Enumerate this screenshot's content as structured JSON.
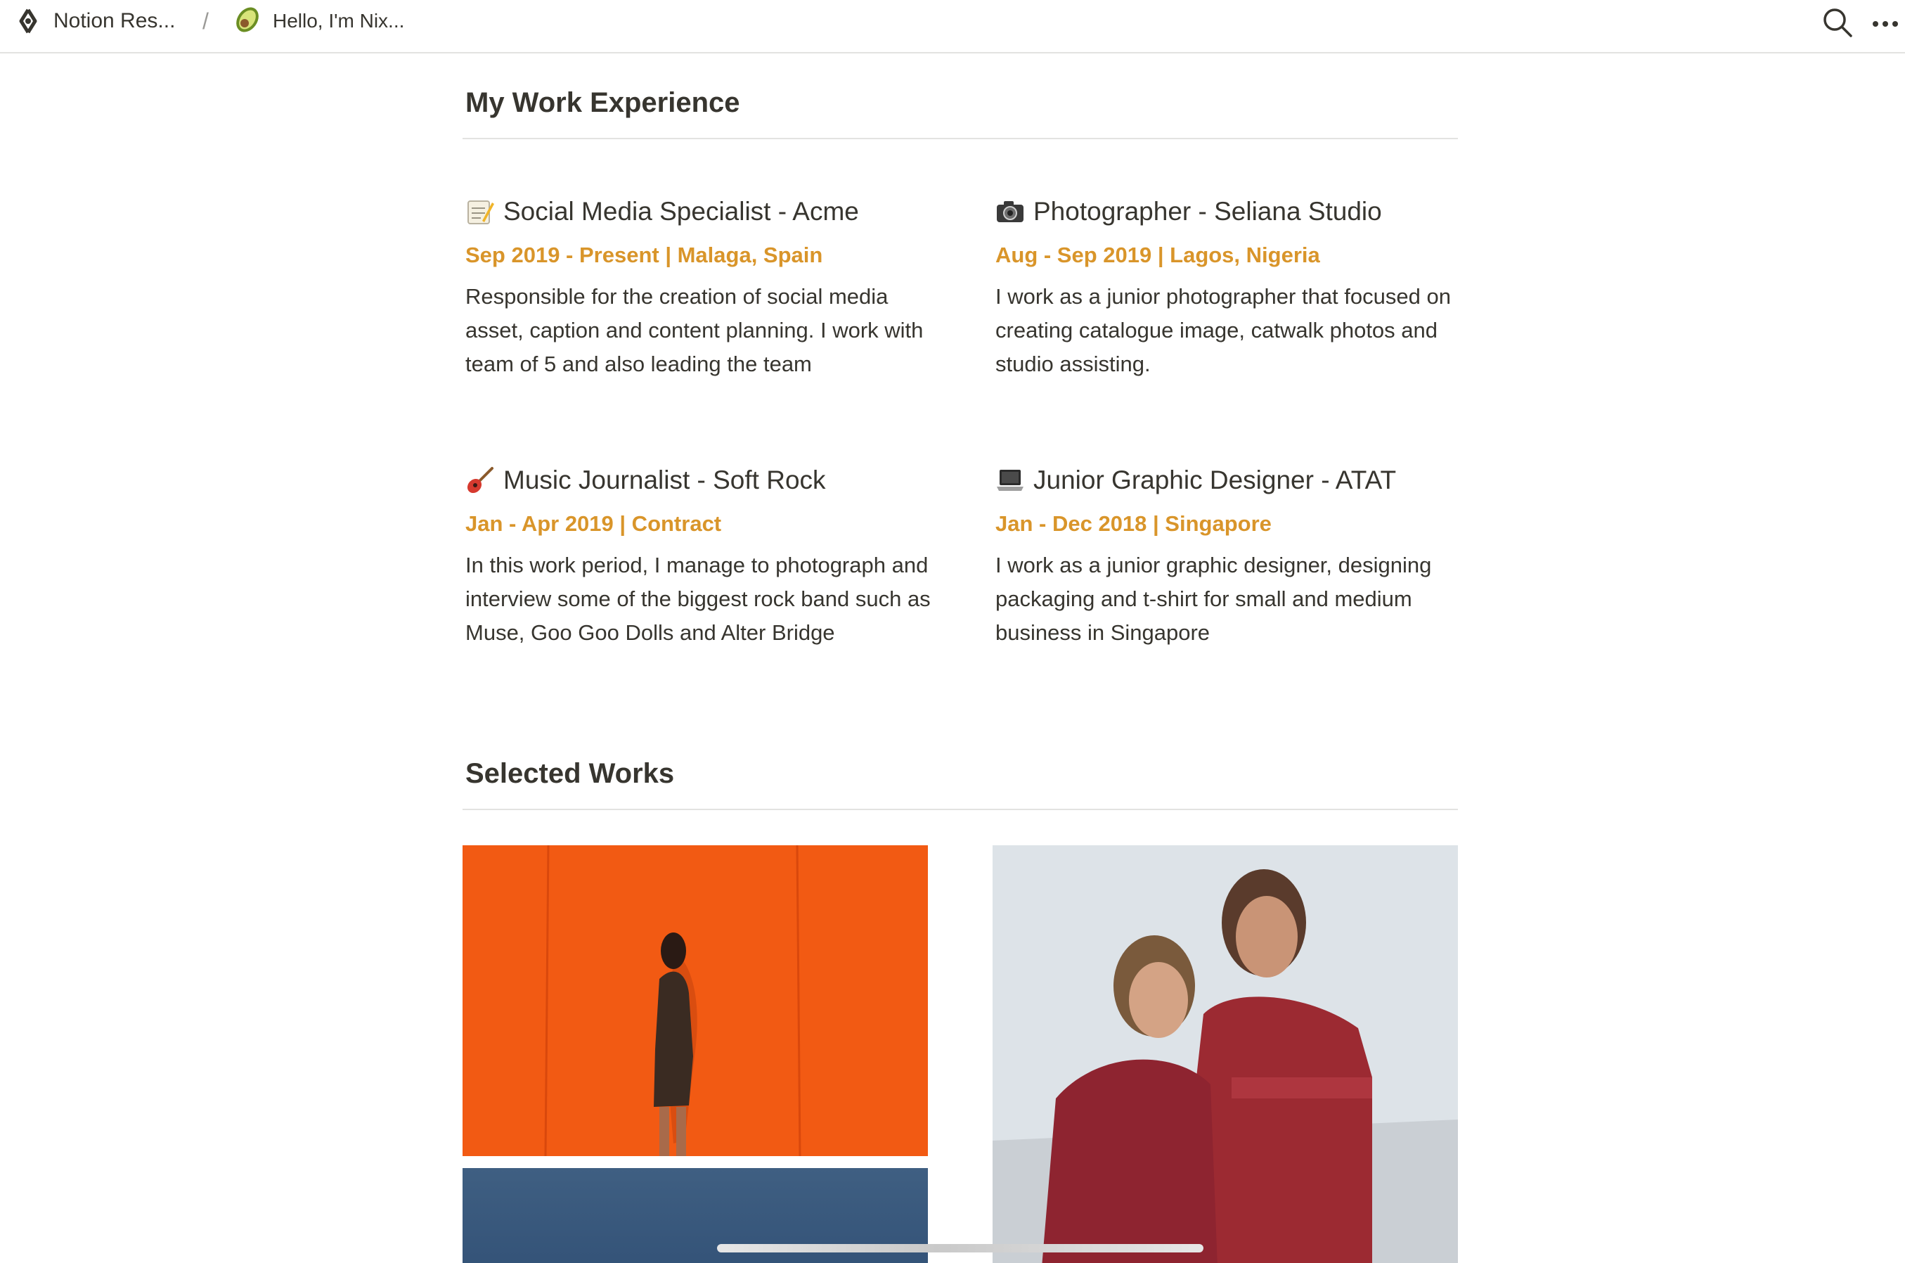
{
  "topbar": {
    "workspace_label": "Notion Res...",
    "separator": "/",
    "page_label": "Hello, I'm Nix...",
    "icons": [
      "notion-logo-icon",
      "avocado-icon",
      "search-icon",
      "more-icon"
    ]
  },
  "experience": {
    "heading": "My Work Experience",
    "jobs": [
      {
        "icon": "memo-icon",
        "title": "Social Media Specialist - Acme",
        "meta": "Sep 2019 - Present | Malaga, Spain",
        "description": "Responsible for the creation of social media asset, caption and content planning. I work with team of 5 and also leading the team"
      },
      {
        "icon": "camera-icon",
        "title": "Photographer - Seliana Studio",
        "meta": "Aug - Sep 2019 | Lagos, Nigeria",
        "description": "I work as a junior photographer that focused on creating catalogue image, catwalk photos and studio assisting."
      },
      {
        "icon": "guitar-icon",
        "title": "Music Journalist - Soft Rock",
        "meta": "Jan - Apr 2019 | Contract",
        "description": "In this work period, I manage to photograph and interview some of the biggest rock band such as Muse, Goo Goo Dolls and Alter Bridge"
      },
      {
        "icon": "laptop-icon",
        "title": "Junior Graphic Designer - ATAT",
        "meta": "Jan - Dec 2018 | Singapore",
        "description": "I work as a junior graphic designer, designing packaging and t-shirt for small and medium business in Singapore"
      }
    ]
  },
  "works": {
    "heading": "Selected Works",
    "photos": [
      "woman-against-orange-wall-photo",
      "blue-photo",
      "two-women-red-sequin-photo"
    ]
  },
  "colors": {
    "text": "#37352f",
    "accent_meta": "#d9952a",
    "divider": "#e3e3e1",
    "orange_photo": "#f25a13"
  }
}
